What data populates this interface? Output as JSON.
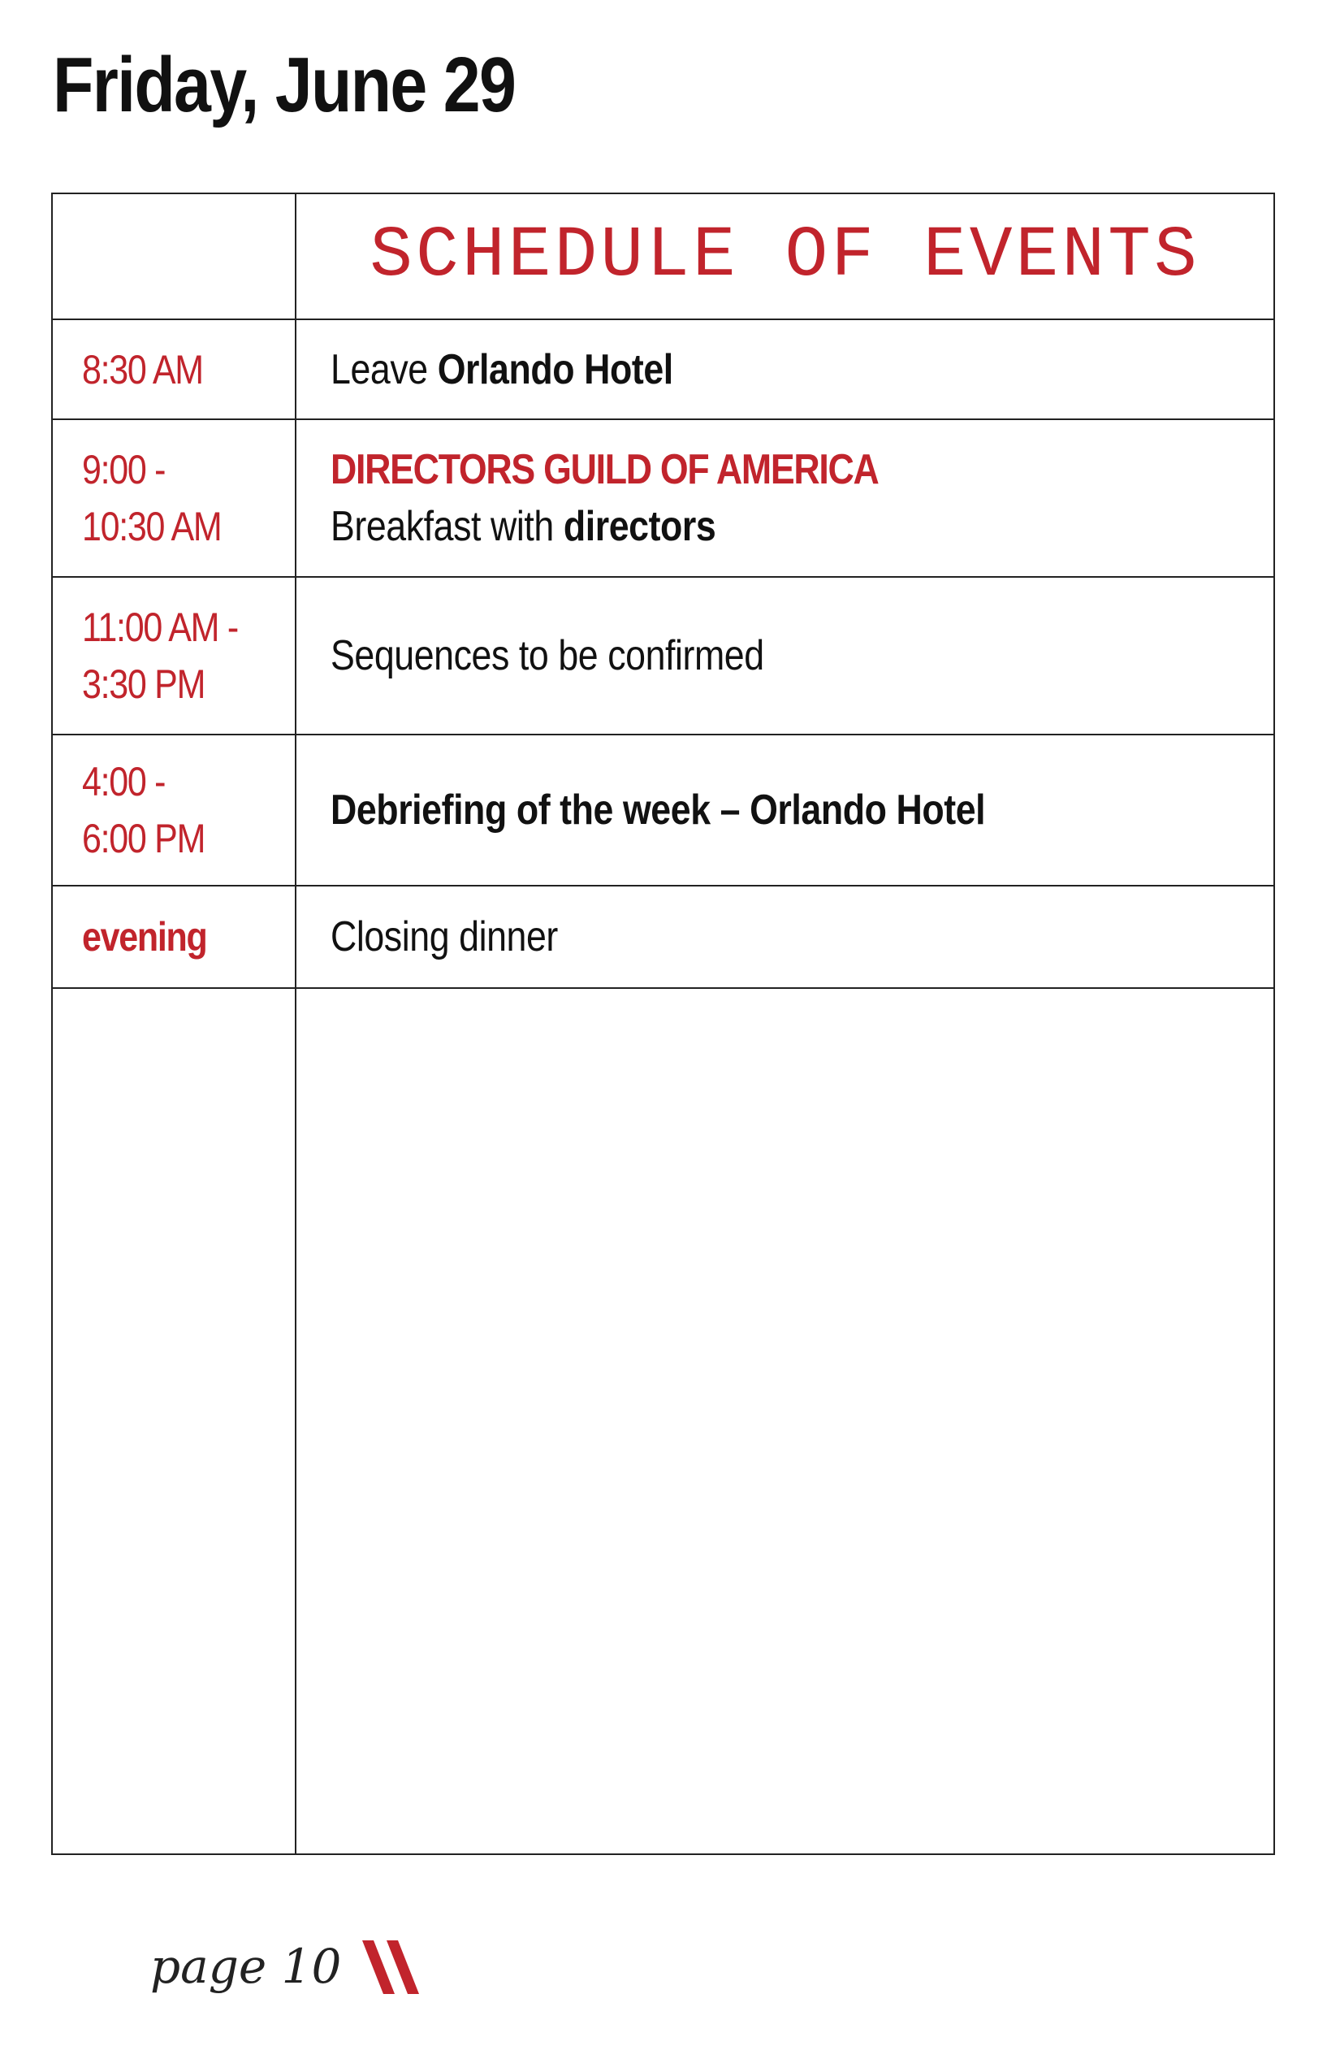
{
  "header": {
    "title": "Friday, June 29"
  },
  "table": {
    "heading": "SCHEDULE OF EVENTS",
    "rows": [
      {
        "time_lines": [
          "8:30 AM"
        ],
        "event_lines": [
          [
            {
              "text": "Leave ",
              "bold": false
            },
            {
              "text": "Orlando Hotel",
              "bold": true
            }
          ]
        ]
      },
      {
        "time_lines": [
          "9:00 -",
          "10:30 AM"
        ],
        "org": "DIRECTORS GUILD OF AMERICA",
        "event_lines": [
          [
            {
              "text": "Breakfast with ",
              "bold": false
            },
            {
              "text": "directors",
              "bold": true
            }
          ]
        ]
      },
      {
        "time_lines": [
          "11:00 AM -",
          "3:30 PM"
        ],
        "event_lines": [
          [
            {
              "text": "Sequences to be confirmed",
              "bold": false
            }
          ]
        ]
      },
      {
        "time_lines": [
          "4:00 -",
          "6:00 PM"
        ],
        "event_lines": [
          [
            {
              "text": "Debriefing of the week – Orlando Hotel",
              "bold": true
            }
          ]
        ]
      },
      {
        "time_lines": [
          "evening"
        ],
        "time_bold": true,
        "event_lines": [
          [
            {
              "text": "Closing dinner",
              "bold": false
            }
          ]
        ]
      }
    ]
  },
  "footer": {
    "page_label": "page 10"
  },
  "colors": {
    "accent": "#c1242c",
    "text": "#111111",
    "border": "#222222"
  }
}
